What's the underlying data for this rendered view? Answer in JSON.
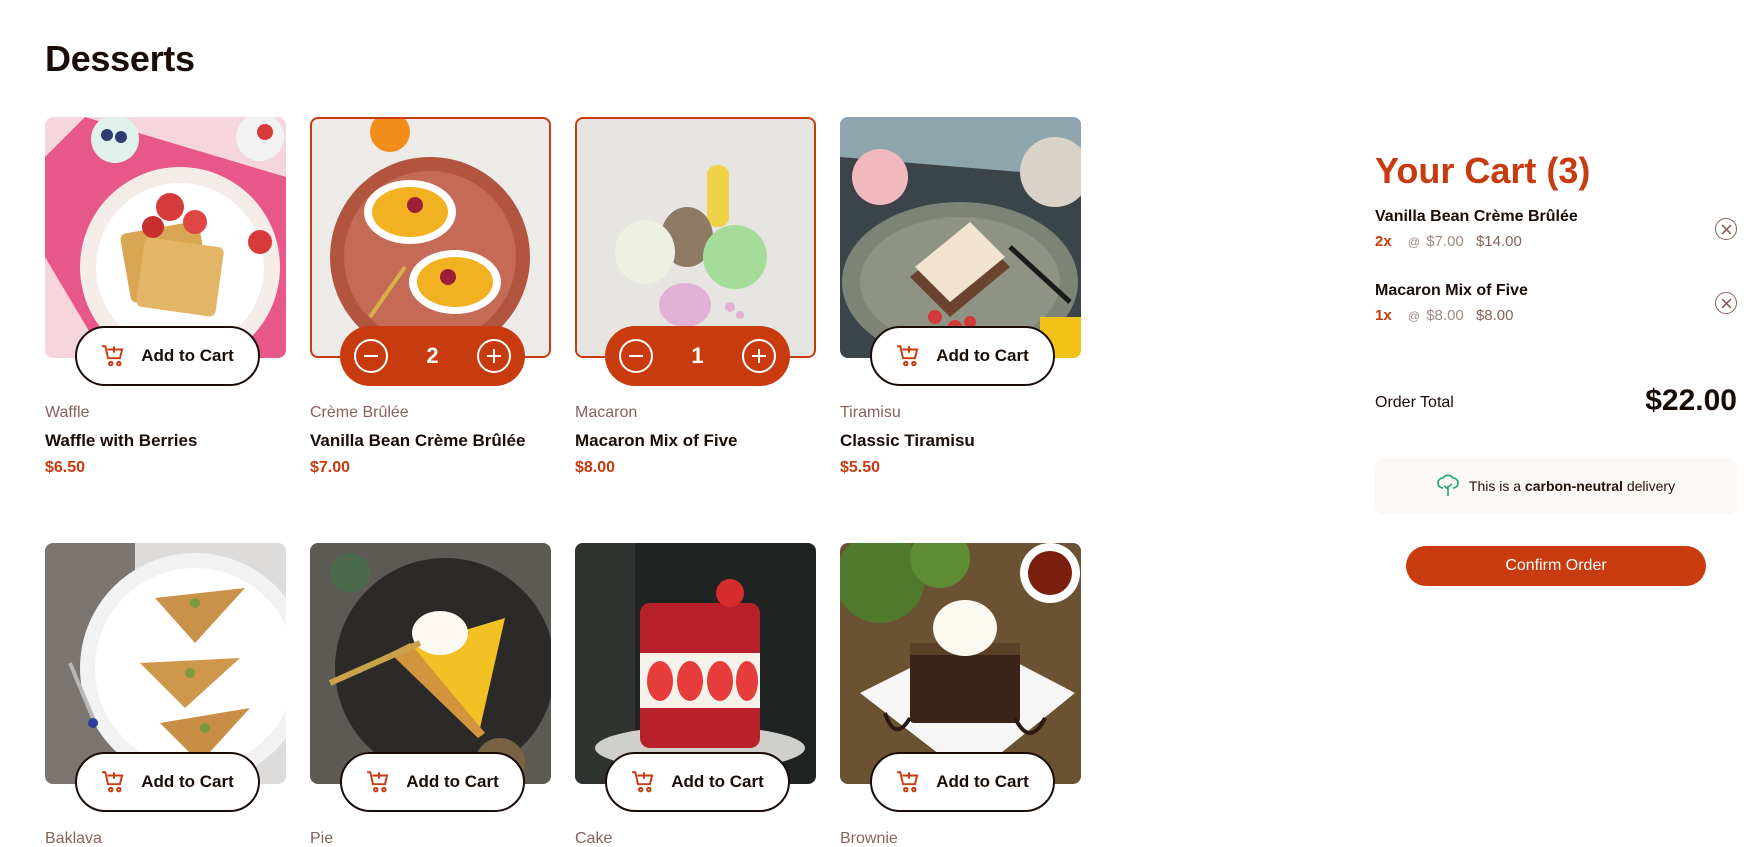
{
  "page": {
    "title": "Desserts"
  },
  "buttons": {
    "add_to_cart": "Add to Cart"
  },
  "products": [
    {
      "category": "Waffle",
      "name": "Waffle with Berries",
      "price": "$6.50",
      "in_cart": false,
      "quantity": ""
    },
    {
      "category": "Crème Brûlée",
      "name": "Vanilla Bean Crème Brûlée",
      "price": "$7.00",
      "in_cart": true,
      "quantity": "2"
    },
    {
      "category": "Macaron",
      "name": "Macaron Mix of Five",
      "price": "$8.00",
      "in_cart": true,
      "quantity": "1"
    },
    {
      "category": "Tiramisu",
      "name": "Classic Tiramisu",
      "price": "$5.50",
      "in_cart": false,
      "quantity": ""
    },
    {
      "category": "Baklava",
      "name": "",
      "price": "",
      "in_cart": false,
      "quantity": ""
    },
    {
      "category": "Pie",
      "name": "",
      "price": "",
      "in_cart": false,
      "quantity": ""
    },
    {
      "category": "Cake",
      "name": "",
      "price": "",
      "in_cart": false,
      "quantity": ""
    },
    {
      "category": "Brownie",
      "name": "",
      "price": "",
      "in_cart": false,
      "quantity": ""
    }
  ],
  "cart": {
    "title": "Your Cart (3)",
    "items": [
      {
        "name": "Vanilla Bean Crème Brûlée",
        "qty": "2x",
        "at": "@",
        "unit_price": "$7.00",
        "line_total": "$14.00"
      },
      {
        "name": "Macaron Mix of Five",
        "qty": "1x",
        "at": "@",
        "unit_price": "$8.00",
        "line_total": "$8.00"
      }
    ],
    "order_total_label": "Order Total",
    "order_total": "$22.00",
    "carbon_prefix": "This is a",
    "carbon_bold": "carbon-neutral",
    "carbon_suffix": "delivery",
    "confirm_label": "Confirm Order"
  },
  "icons": {
    "cart": "add-to-cart-icon",
    "decrement": "minus-circle-icon",
    "increment": "plus-circle-icon",
    "remove": "remove-item-icon",
    "carbon": "tree-icon"
  },
  "colors": {
    "accent": "#c73b0f",
    "text_dark": "#1a0d08",
    "muted": "#87635a",
    "carbon_bg": "#fcf8f6",
    "carbon_icon": "#1ea575"
  }
}
